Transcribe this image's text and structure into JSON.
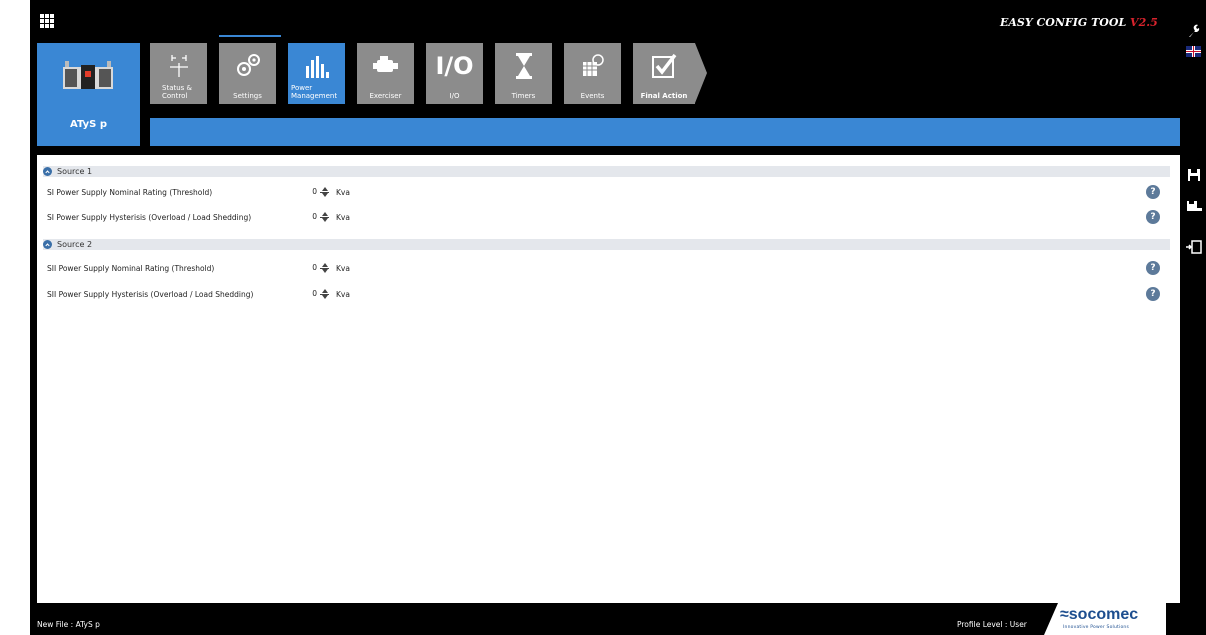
{
  "app": {
    "title": "EASY CONFIG TOOL",
    "version": "V2.5"
  },
  "device": {
    "label": "ATyS p"
  },
  "nav": {
    "tiles": [
      {
        "label_line1": "Status &",
        "label_line2": "Control",
        "icon": "status-control-icon"
      },
      {
        "label": "Settings",
        "icon": "settings-gears-icon"
      },
      {
        "label_line1": "Power",
        "label_line2": "Management",
        "icon": "power-management-icon",
        "active": true
      },
      {
        "label": "Exerciser",
        "icon": "exerciser-icon"
      },
      {
        "label": "I/O",
        "icon_text": "I/O"
      },
      {
        "label": "Timers",
        "icon": "hourglass-icon"
      },
      {
        "label": "Events",
        "icon": "events-icon"
      },
      {
        "label": "Final Action",
        "icon": "checkmark-icon"
      }
    ]
  },
  "sections": [
    {
      "title": "Source 1",
      "rows": [
        {
          "label": "SI Power Supply Nominal Rating (Threshold)",
          "value": "0",
          "unit": "Kva"
        },
        {
          "label": "SI Power Supply Hysterisis (Overload / Load Shedding)",
          "value": "0",
          "unit": "Kva"
        }
      ]
    },
    {
      "title": "Source 2",
      "rows": [
        {
          "label": "SII Power Supply Nominal Rating (Threshold)",
          "value": "0",
          "unit": "Kva"
        },
        {
          "label": "SII Power Supply Hysterisis (Overload / Load Shedding)",
          "value": "0",
          "unit": "Kva"
        }
      ]
    }
  ],
  "footer": {
    "file": "New File : ATyS p",
    "profile": "Profile Level : User",
    "logo_text": "socomec",
    "logo_tagline": "Innovative Power Solutions"
  },
  "colors": {
    "accent": "#3a87d4",
    "tile_gray": "#8c8c8c",
    "version_red": "#d9232d",
    "section_bg": "#e4e7ec"
  }
}
